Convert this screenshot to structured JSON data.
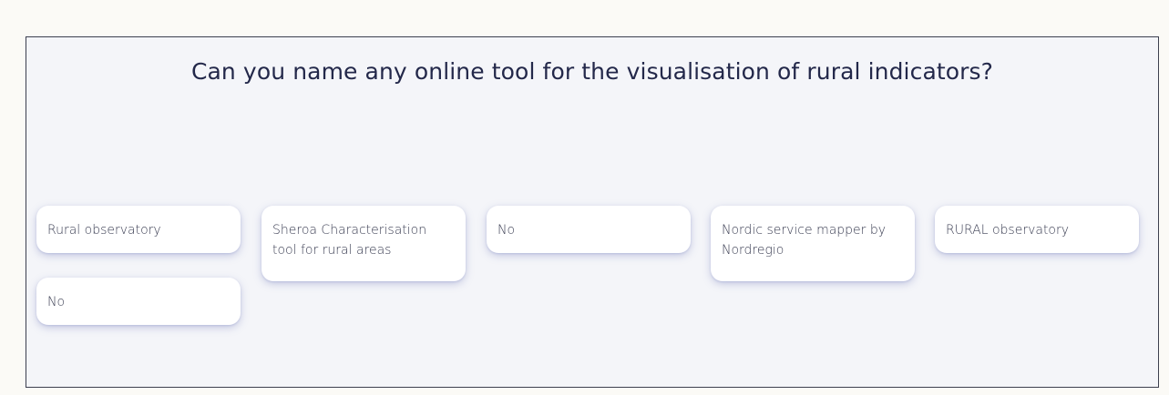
{
  "question": "Can you name any online tool for the visualisation of rural indicators?",
  "responses": [
    "Rural observatory",
    "Sheroa Characterisation tool for rural areas",
    "No",
    "Nordic service mapper by Nordregio",
    "RURAL observatory",
    "No"
  ]
}
